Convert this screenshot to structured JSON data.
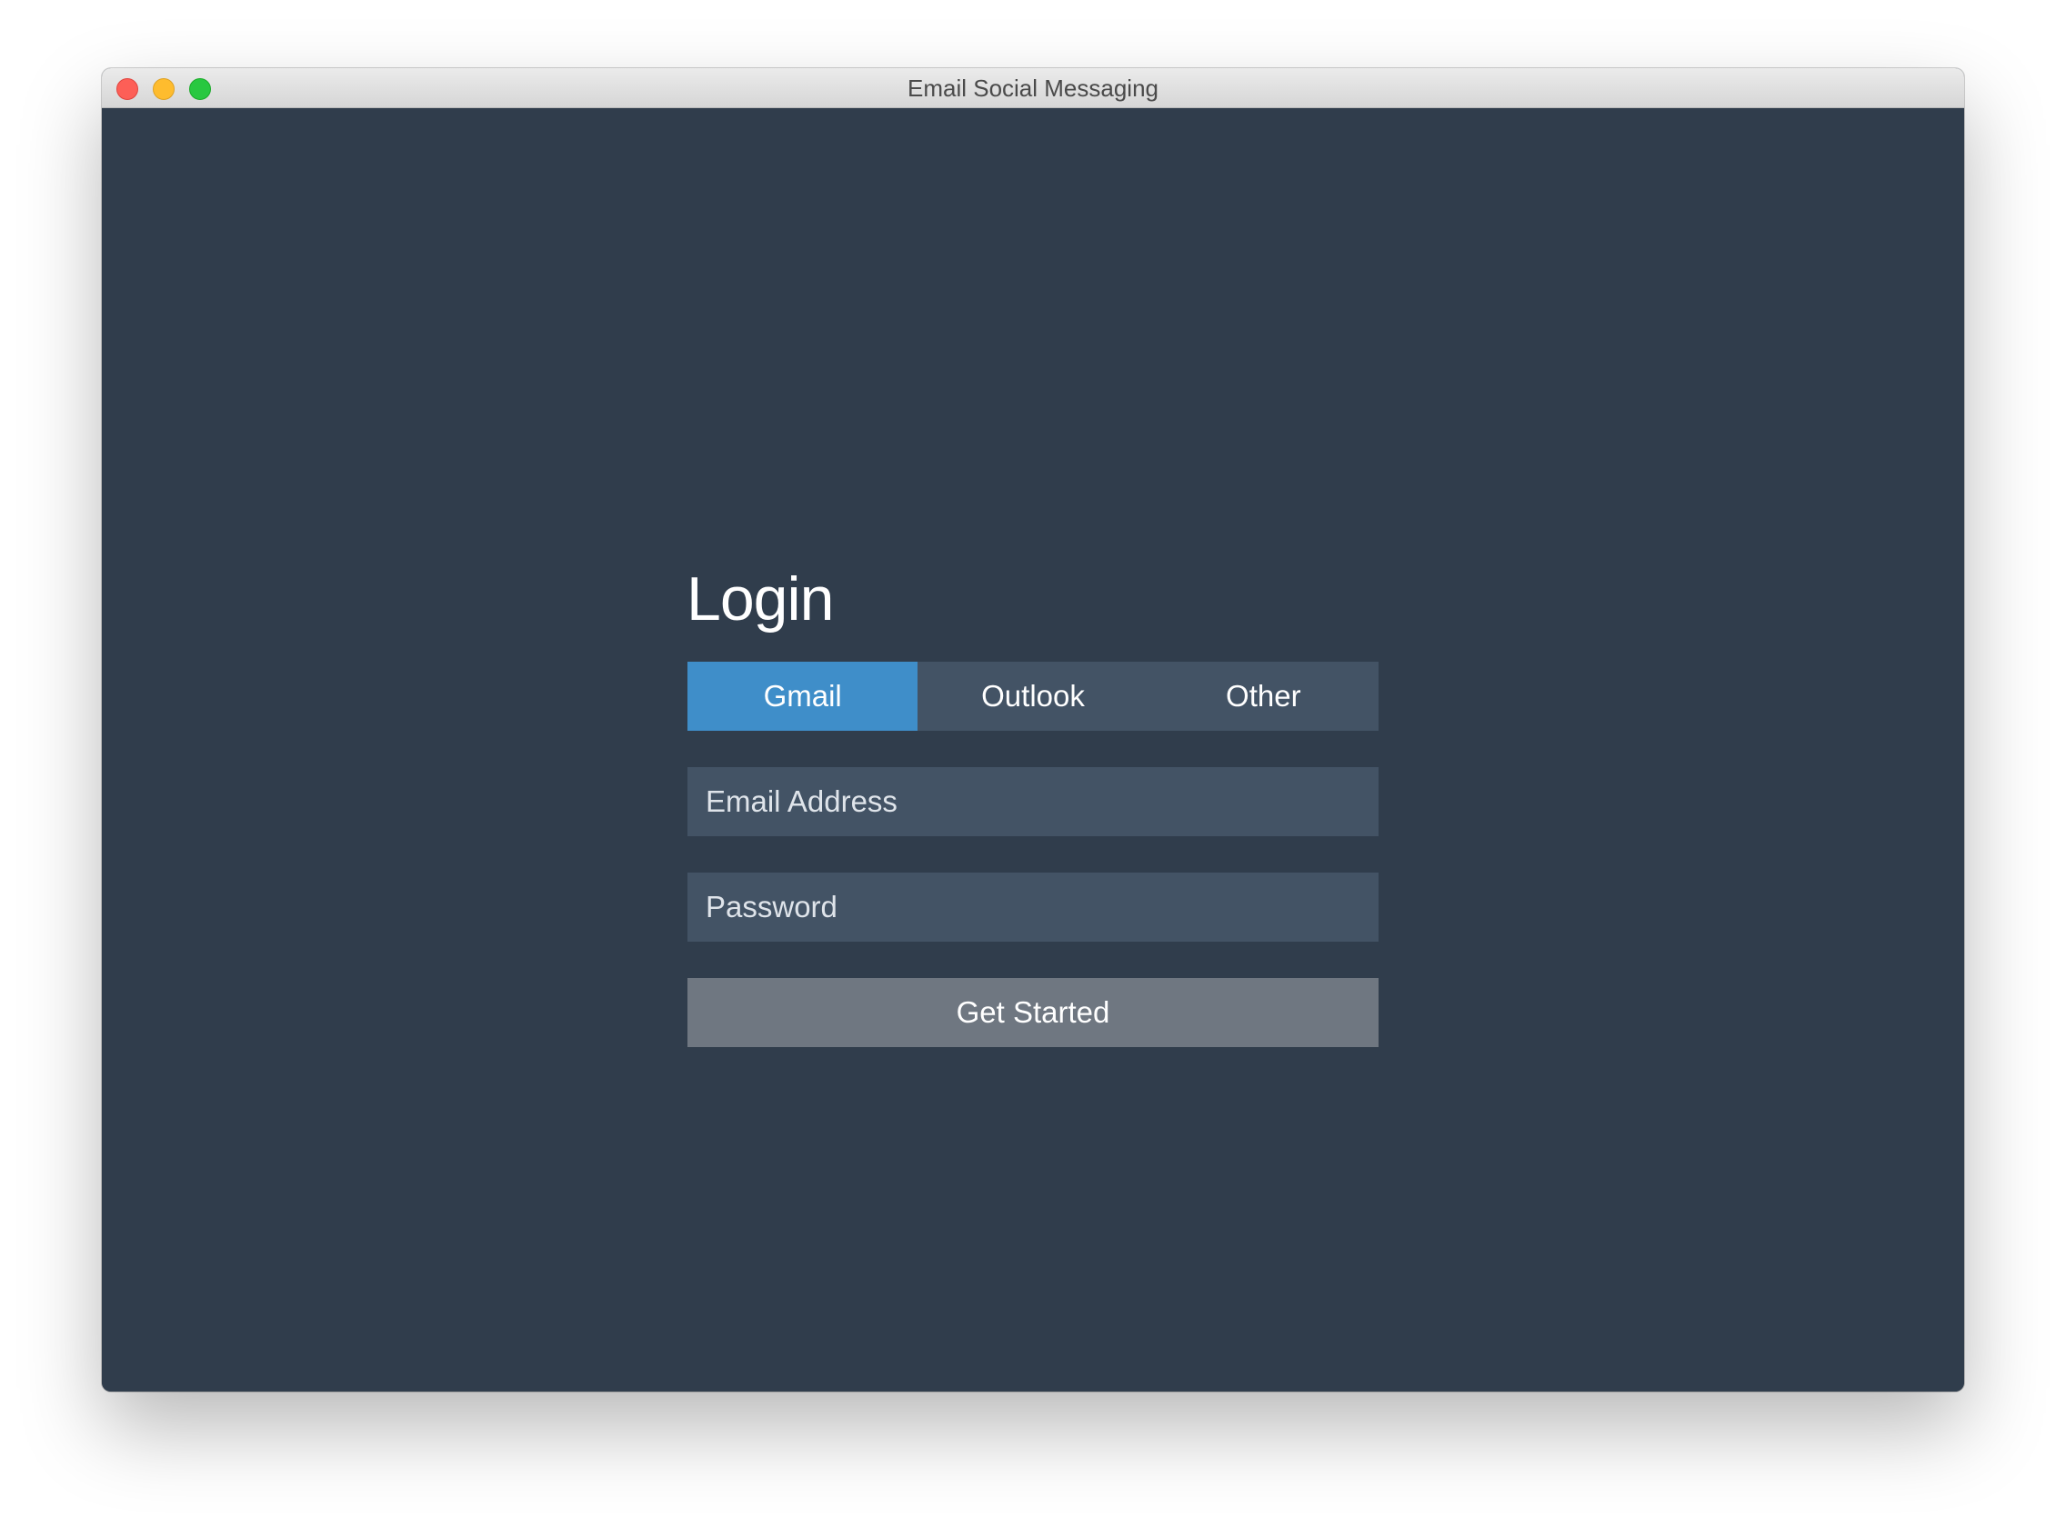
{
  "window": {
    "title": "Email Social Messaging"
  },
  "login": {
    "heading": "Login",
    "tabs": [
      {
        "label": "Gmail",
        "active": true
      },
      {
        "label": "Outlook",
        "active": false
      },
      {
        "label": "Other",
        "active": false
      }
    ],
    "email": {
      "placeholder": "Email Address",
      "value": ""
    },
    "password": {
      "placeholder": "Password",
      "value": ""
    },
    "submit_label": "Get Started"
  },
  "colors": {
    "background": "#303d4c",
    "field": "#435365",
    "accent": "#3f8ec9",
    "button": "#6f7781"
  }
}
